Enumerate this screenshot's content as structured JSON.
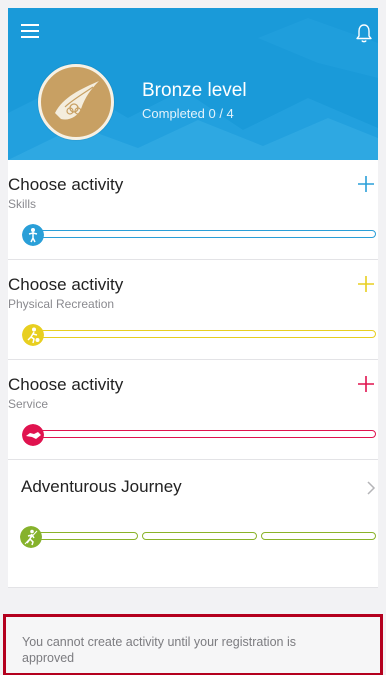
{
  "header": {
    "level_title": "Bronze level",
    "completed_text": "Completed 0 / 4",
    "icons": {
      "menu": "hamburger-menu-icon",
      "notifications": "bell-icon",
      "badge": "bronze-award-badge"
    },
    "background_color": "#1a9ad9"
  },
  "activities": [
    {
      "title": "Choose activity",
      "subtitle": "Skills",
      "color": "#2a9fd8",
      "icon": "skills-icon",
      "progress": 0
    },
    {
      "title": "Choose activity",
      "subtitle": "Physical Recreation",
      "color": "#e8cf20",
      "icon": "physical-recreation-icon",
      "progress": 0
    },
    {
      "title": "Choose activity",
      "subtitle": "Service",
      "color": "#e0134f",
      "icon": "service-handshake-icon",
      "progress": 0
    }
  ],
  "journey": {
    "title": "Adventurous Journey",
    "color": "#86b22c",
    "icon": "adventurous-journey-icon",
    "segments": 3,
    "progress": 0
  },
  "notice": {
    "text": "You cannot create activity until your registration is approved",
    "border_color": "#b4001e"
  }
}
